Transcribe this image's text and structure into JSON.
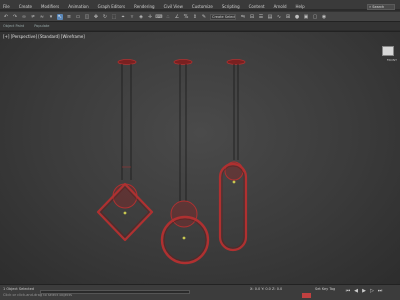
{
  "menu": [
    "File",
    "Create",
    "Modifiers",
    "Animation",
    "Graph Editors",
    "Rendering",
    "Civil View",
    "Customize",
    "Scripting",
    "Content",
    "Arnold",
    "Help"
  ],
  "search": {
    "label": "Search"
  },
  "toolbar": {
    "selection_set_label": "Create Selection Set"
  },
  "ribbon": [
    "Object Paint",
    "Populate"
  ],
  "viewport": {
    "label": "[+] [Perspective] [Standard] [Wireframe]",
    "viewcube_label": "FRONT"
  },
  "status": {
    "selection": "1 Object Selected",
    "prompt": "Click or click-and-drag to select objects",
    "coords": "X: 0.0   Y: 0.0   Z: 0.0",
    "key_label": "Set Key Tag",
    "wire_color": "#b03030",
    "cable_color": "#1a1a1a"
  }
}
